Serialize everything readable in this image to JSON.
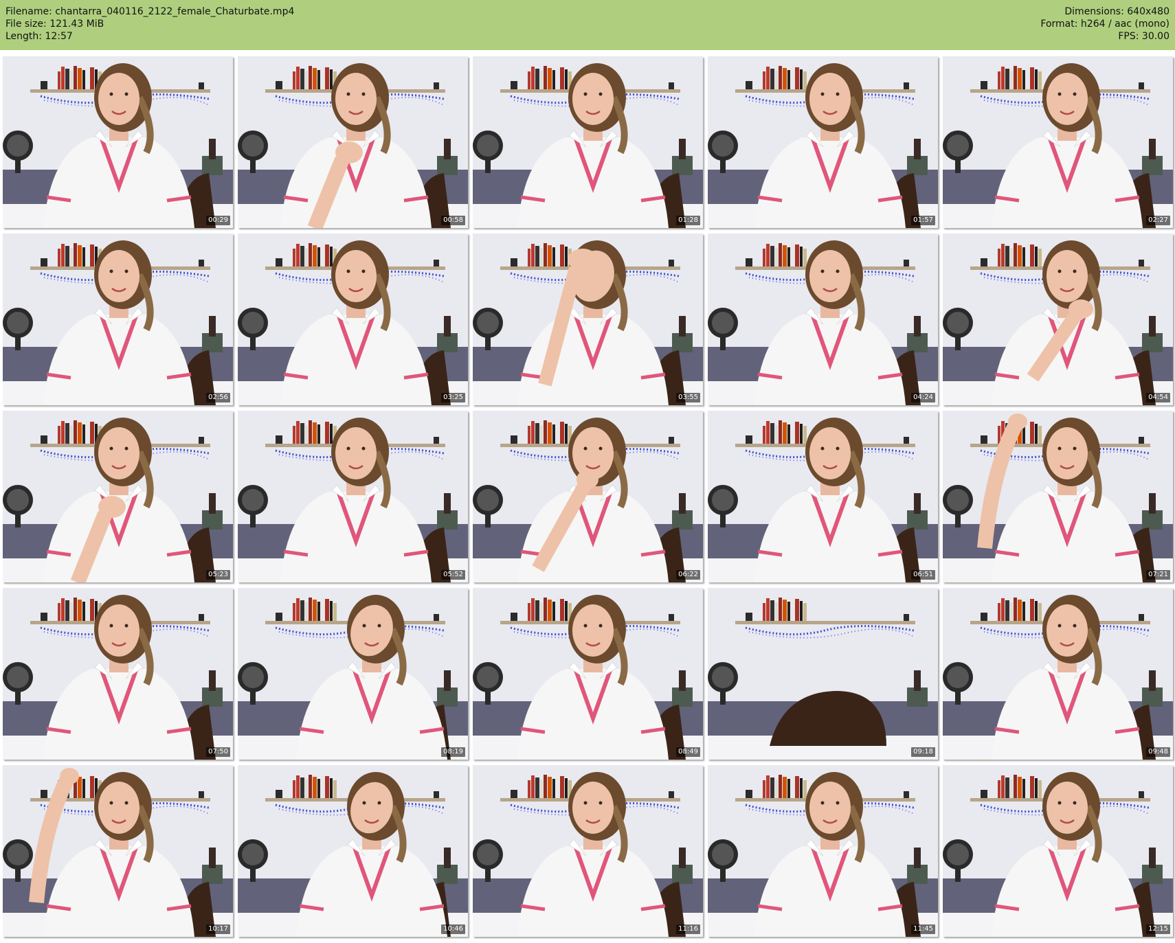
{
  "header": {
    "filename": "Filename: chantarra_040116_2122_female_Chaturbate.mp4",
    "filesize": "File size: 121.43 MiB",
    "length": "Length: 12:57",
    "dimensions": "Dimensions: 640x480",
    "format": "Format: h264 / aac (mono)",
    "fps": "FPS: 30.00",
    "bg_color": "#afcf7f"
  },
  "grid": {
    "columns": 5,
    "rows": 5
  },
  "thumbnails": [
    {
      "timestamp": "00:29",
      "pose": "neutral"
    },
    {
      "timestamp": "00:58",
      "pose": "hand-chest"
    },
    {
      "timestamp": "01:28",
      "pose": "neutral"
    },
    {
      "timestamp": "01:57",
      "pose": "neutral"
    },
    {
      "timestamp": "02:27",
      "pose": "neutral"
    },
    {
      "timestamp": "02:56",
      "pose": "neutral"
    },
    {
      "timestamp": "03:25",
      "pose": "neutral"
    },
    {
      "timestamp": "03:55",
      "pose": "hand-head"
    },
    {
      "timestamp": "04:24",
      "pose": "neutral"
    },
    {
      "timestamp": "04:54",
      "pose": "hand-shoulder"
    },
    {
      "timestamp": "05:23",
      "pose": "hand-chest"
    },
    {
      "timestamp": "05:52",
      "pose": "neutral"
    },
    {
      "timestamp": "06:22",
      "pose": "hand-chin"
    },
    {
      "timestamp": "06:51",
      "pose": "neutral"
    },
    {
      "timestamp": "07:21",
      "pose": "arm-raised"
    },
    {
      "timestamp": "07:50",
      "pose": "neutral"
    },
    {
      "timestamp": "08:19",
      "pose": "looking-down"
    },
    {
      "timestamp": "08:49",
      "pose": "neutral"
    },
    {
      "timestamp": "09:18",
      "pose": "empty-pillow"
    },
    {
      "timestamp": "09:48",
      "pose": "neutral"
    },
    {
      "timestamp": "10:17",
      "pose": "arm-raised"
    },
    {
      "timestamp": "10:46",
      "pose": "looking-down"
    },
    {
      "timestamp": "11:16",
      "pose": "neutral"
    },
    {
      "timestamp": "11:45",
      "pose": "neutral"
    },
    {
      "timestamp": "12:15",
      "pose": "neutral"
    }
  ]
}
